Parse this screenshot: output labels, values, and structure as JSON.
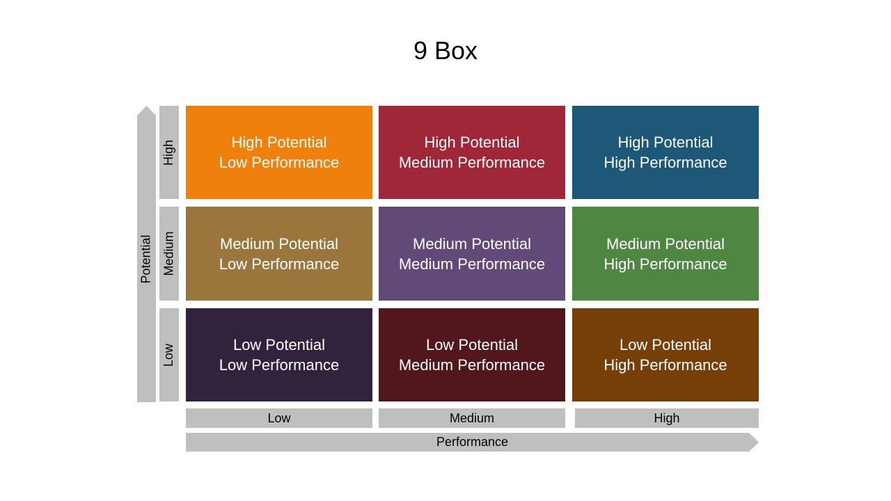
{
  "title": "9 Box",
  "axes": {
    "y_axis_label": "Potential",
    "x_axis_label": "Performance",
    "y_levels": [
      "High",
      "Medium",
      "Low"
    ],
    "x_levels": [
      "Low",
      "Medium",
      "High"
    ]
  },
  "grid": [
    [
      {
        "line1": "High Potential",
        "line2": "Low Performance",
        "color": "#f0800c"
      },
      {
        "line1": "High Potential",
        "line2": "Medium Performance",
        "color": "#a02737"
      },
      {
        "line1": "High Potential",
        "line2": "High Performance",
        "color": "#1d5879"
      }
    ],
    [
      {
        "line1": "Medium Potential",
        "line2": "Low Performance",
        "color": "#9a763c"
      },
      {
        "line1": "Medium Potential",
        "line2": "Medium Performance",
        "color": "#614a77"
      },
      {
        "line1": "Medium Potential",
        "line2": "High Performance",
        "color": "#4e8742"
      }
    ],
    [
      {
        "line1": "Low Potential",
        "line2": "Low Performance",
        "color": "#31233d"
      },
      {
        "line1": "Low Potential",
        "line2": "Medium Performance",
        "color": "#52161d"
      },
      {
        "line1": "Low Potential",
        "line2": "High Performance",
        "color": "#773f08"
      }
    ]
  ]
}
